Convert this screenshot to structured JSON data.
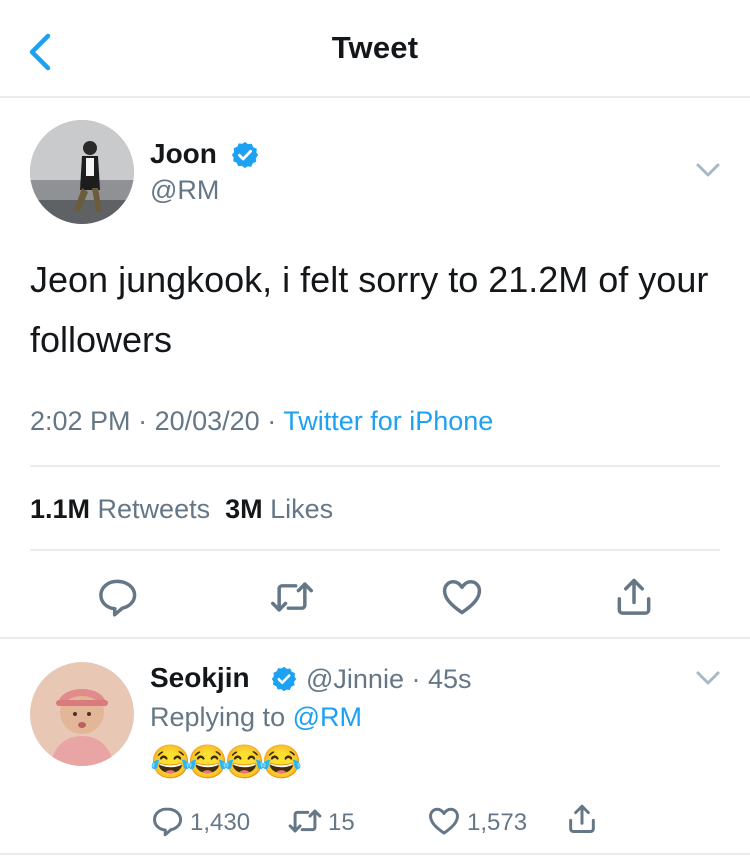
{
  "header": {
    "title": "Tweet"
  },
  "tweet": {
    "author_name": "Joon",
    "author_handle": "@RM",
    "text": "Jeon jungkook, i felt sorry to 21.2M of your followers",
    "time": "2:02 PM",
    "date": "20/03/20",
    "source": "Twitter for iPhone",
    "retweets_count": "1.1M",
    "retweets_label": "Retweets",
    "likes_count": "3M",
    "likes_label": "Likes"
  },
  "reply": {
    "author_name": "Seokjin",
    "author_handle": "@Jinnie",
    "age": "45s",
    "replying_to_label": "Replying to",
    "replying_to_handle": "@RM",
    "text": "😂😂😂😂",
    "reply_count": "1,430",
    "retweet_count": "15",
    "like_count": "1,573"
  },
  "colors": {
    "accent": "#1da1f2",
    "secondary_text": "#657786",
    "icon": "#657786",
    "divider": "#e6ecf0"
  },
  "icons": [
    "back-chevron-icon",
    "verified-badge-icon",
    "chevron-down-icon",
    "reply-icon",
    "retweet-icon",
    "like-icon",
    "share-icon"
  ]
}
